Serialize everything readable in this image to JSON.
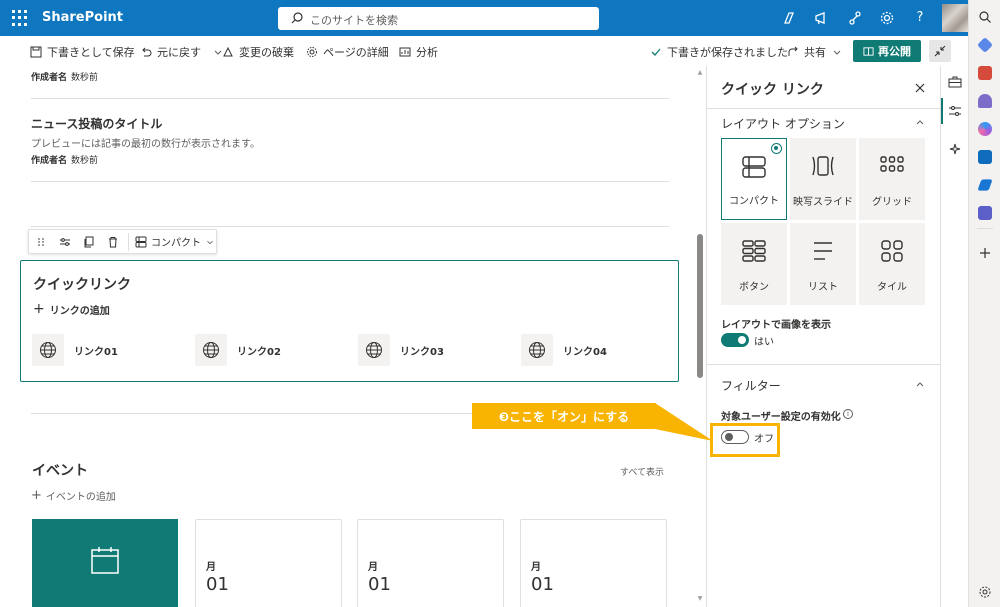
{
  "suite": {
    "brand": "SharePoint",
    "search_placeholder": "このサイトを検索",
    "icons": [
      "waffle-icon",
      "search-icon",
      "copilot-icon",
      "megaphone-icon",
      "share-icon",
      "gear-icon",
      "help-icon"
    ],
    "help_glyph": "?"
  },
  "command_bar": {
    "save_draft": "下書きとして保存",
    "undo": "元に戻す",
    "discard": "変更の破棄",
    "page_details": "ページの詳細",
    "analytics": "分析",
    "saved_status": "下書きが保存されました",
    "share": "共有",
    "republish": "再公開"
  },
  "canvas": {
    "author_label": "作成者名",
    "author_time": "数秒前",
    "news_title": "ニュース投稿のタイトル",
    "news_preview": "プレビューには記事の最初の数行が表示されます。",
    "toolbar_layout": "コンパクト",
    "quicklinks": {
      "title": "クイックリンク",
      "add_label": "リンクの追加",
      "links": [
        "リンク01",
        "リンク02",
        "リンク03",
        "リンク04"
      ]
    },
    "events": {
      "title": "イベント",
      "see_all": "すべて表示",
      "add_label": "イベントの追加",
      "cards": [
        {
          "month": "月",
          "day": "01"
        },
        {
          "month": "月",
          "day": "01"
        },
        {
          "month": "月",
          "day": "01"
        }
      ]
    }
  },
  "pane": {
    "title": "クイック リンク",
    "layout_section": "レイアウト オプション",
    "layouts": [
      "コンパクト",
      "映写スライド",
      "グリッド",
      "ボタン",
      "リスト",
      "タイル"
    ],
    "selected_layout": "コンパクト",
    "show_images_label": "レイアウトで画像を表示",
    "show_images_value": "はい",
    "filter_section": "フィルター",
    "audience_label": "対象ユーザー設定の有効化",
    "audience_value": "オフ"
  },
  "annotation": {
    "text": "❸ここを「オン」にする",
    "color": "#f8b400"
  },
  "colors": {
    "suite_blue": "#0f77c0",
    "teal": "#107a74"
  }
}
